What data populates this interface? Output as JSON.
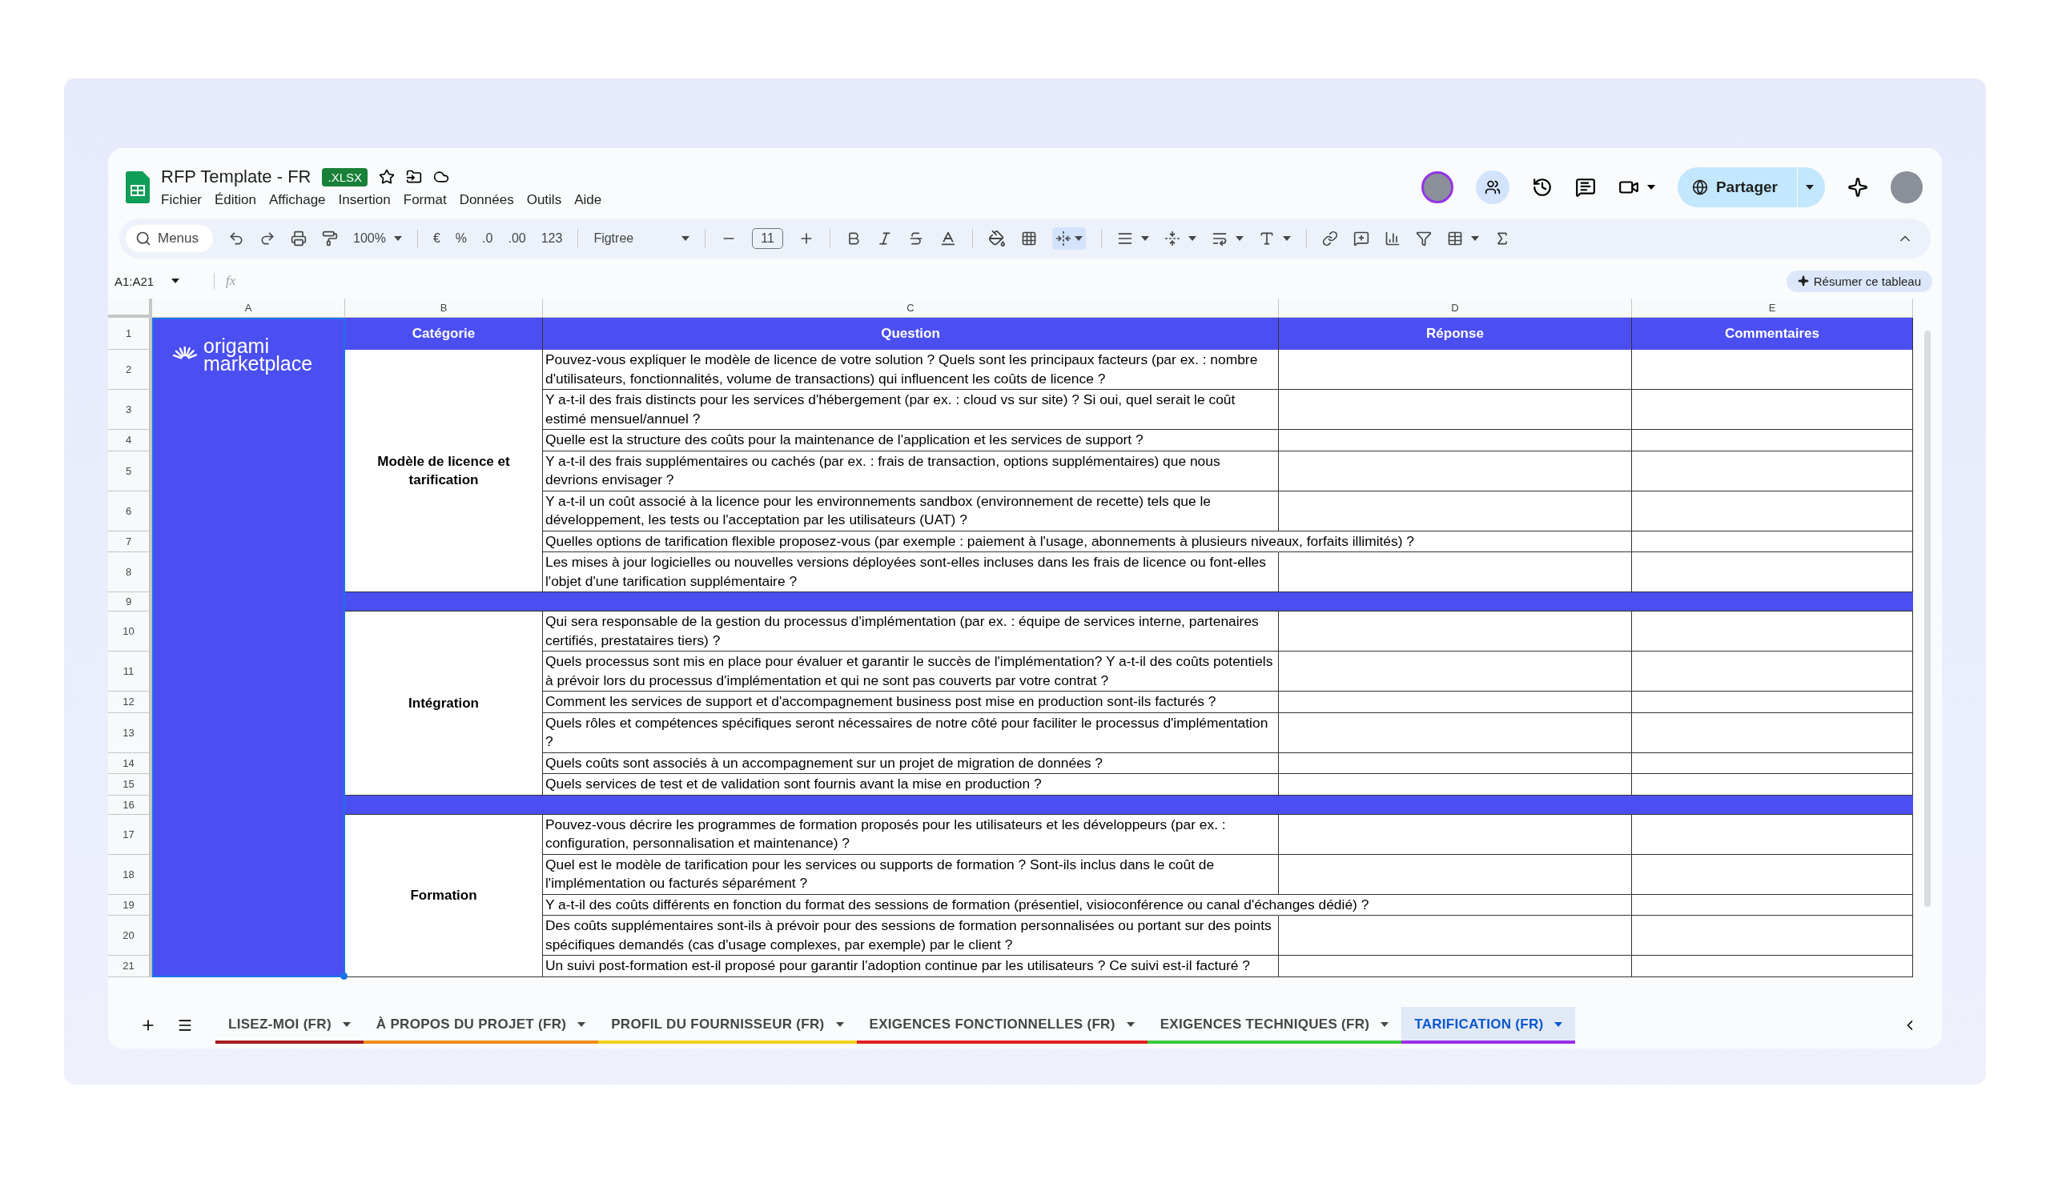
{
  "document": {
    "title": "RFP Template - FR",
    "badge": ".XLSX"
  },
  "menu": [
    "Fichier",
    "Édition",
    "Affichage",
    "Insertion",
    "Format",
    "Données",
    "Outils",
    "Aide"
  ],
  "share_button": "Partager",
  "toolbar": {
    "search": {
      "placeholder": "Menus"
    },
    "zoom": "100%",
    "currency": "€",
    "percent": "%",
    "decrease_decimals": ".0",
    "increase_decimals": ".00",
    "number_format": "123",
    "font": "Figtree",
    "font_size": "11"
  },
  "formula_bar": {
    "name_box": "A1:A21",
    "fx": "fx",
    "summarize_button": "Résumer ce tableau"
  },
  "sheet": {
    "columns": [
      "A",
      "B",
      "C",
      "D",
      "E"
    ],
    "row_numbers": [
      "1",
      "2",
      "3",
      "4",
      "5",
      "6",
      "7",
      "8",
      "9",
      "10",
      "11",
      "12",
      "13",
      "14",
      "15",
      "16",
      "17",
      "18",
      "19",
      "20",
      "21"
    ],
    "logo": {
      "line1": "origami",
      "line2": "marketplace"
    },
    "headers": [
      "Catégorie",
      "Question",
      "Réponse",
      "Commentaires"
    ],
    "groups": [
      {
        "category": "Modèle de licence et tarification",
        "questions": [
          {
            "kind": "wrapped",
            "text": "Pouvez-vous expliquer le modèle de licence de votre solution ? Quels sont les principaux facteurs (par ex. : nombre d'utilisateurs, fonctionnalités, volume de transactions) qui influencent les coûts de licence ?"
          },
          {
            "kind": "wrapped",
            "text": "Y a-t-il des frais distincts pour les services d'hébergement (par ex. : cloud vs sur site) ? Si oui, quel serait le coût estimé mensuel/annuel ?"
          },
          {
            "kind": "wrapped",
            "text": "Quelle est la structure des coûts pour la maintenance de l'application et les services de support ?"
          },
          {
            "kind": "wrapped",
            "text": "Y a-t-il des frais supplémentaires ou cachés (par ex. : frais de transaction, options supplémentaires) que nous devrions envisager ?"
          },
          {
            "kind": "wrapped",
            "text": "Y a-t-il un coût associé à la licence pour les environnements sandbox (environnement de recette) tels que le développement, les tests ou l'acceptation par les utilisateurs (UAT) ?"
          },
          {
            "kind": "overflow",
            "text": "Quelles options de tarification flexible proposez-vous (par exemple : paiement à l'usage, abonnements à plusieurs niveaux, forfaits illimités) ?"
          },
          {
            "kind": "wrapped",
            "text": "Les mises à jour logicielles ou nouvelles versions déployées sont-elles incluses dans les frais de licence ou font-elles l'objet d'une tarification supplémentaire ?"
          }
        ]
      },
      {
        "category": "Intégration",
        "questions": [
          {
            "kind": "wrapped",
            "text": "Qui sera responsable de la gestion du processus d'implémentation (par ex. : équipe de services interne, partenaires certifiés, prestataires tiers) ?"
          },
          {
            "kind": "wrapped",
            "text": "Quels processus sont mis en place pour évaluer et garantir le succès de l'implémentation? Y a-t-il des coûts potentiels à prévoir lors du processus d'implémentation et qui ne sont pas couverts par votre contrat ?"
          },
          {
            "kind": "wrapped",
            "text": "Comment les services de support et d'accompagnement business post mise en production sont-ils facturés ?"
          },
          {
            "kind": "wrapped",
            "text": "Quels rôles et compétences spécifiques seront nécessaires de notre côté pour faciliter le processus d'implémentation ?"
          },
          {
            "kind": "wrapped",
            "text": "Quels coûts sont associés à un accompagnement sur un projet de migration de données ?"
          },
          {
            "kind": "wrapped",
            "text": "Quels services de test et de validation sont fournis avant la mise en production ?"
          }
        ]
      },
      {
        "category": "Formation",
        "questions": [
          {
            "kind": "wrapped",
            "text": "Pouvez-vous décrire les programmes de formation proposés pour les utilisateurs et les développeurs (par ex. : configuration, personnalisation et maintenance) ?"
          },
          {
            "kind": "wrapped",
            "text": "Quel est le modèle de tarification pour les services ou supports de formation ? Sont-ils inclus dans le coût de l'implémentation ou facturés séparément ?"
          },
          {
            "kind": "overflow",
            "text": "Y a-t-il des coûts différents en fonction du format des sessions de formation (présentiel, visioconférence ou canal d'échanges dédié) ?"
          },
          {
            "kind": "wrapped",
            "text": "Des coûts supplémentaires sont-ils à prévoir pour des sessions de formation personnalisées ou portant sur des points spécifiques demandés (cas d'usage complexes, par exemple) par le client ?"
          },
          {
            "kind": "wrapped",
            "text": "Un suivi post-formation est-il proposé pour garantir l'adoption continue par les utilisateurs ? Ce suivi est-il facturé ?"
          }
        ]
      }
    ]
  },
  "tabs": [
    {
      "label": "LISEZ-MOI (FR)",
      "color": "#a61c1c",
      "selected": false
    },
    {
      "label": "À PROPOS DU PROJET (FR)",
      "color": "#f08c1a",
      "selected": false
    },
    {
      "label": "PROFIL DU FOURNISSEUR (FR)",
      "color": "#f2d01c",
      "selected": false
    },
    {
      "label": "EXIGENCES FONCTIONNELLES (FR)",
      "color": "#e02020",
      "selected": false
    },
    {
      "label": "EXIGENCES TECHNIQUES (FR)",
      "color": "#3cc83c",
      "selected": false
    },
    {
      "label": "TARIFICATION (FR)",
      "color": "#9a2ee6",
      "selected": true
    }
  ]
}
